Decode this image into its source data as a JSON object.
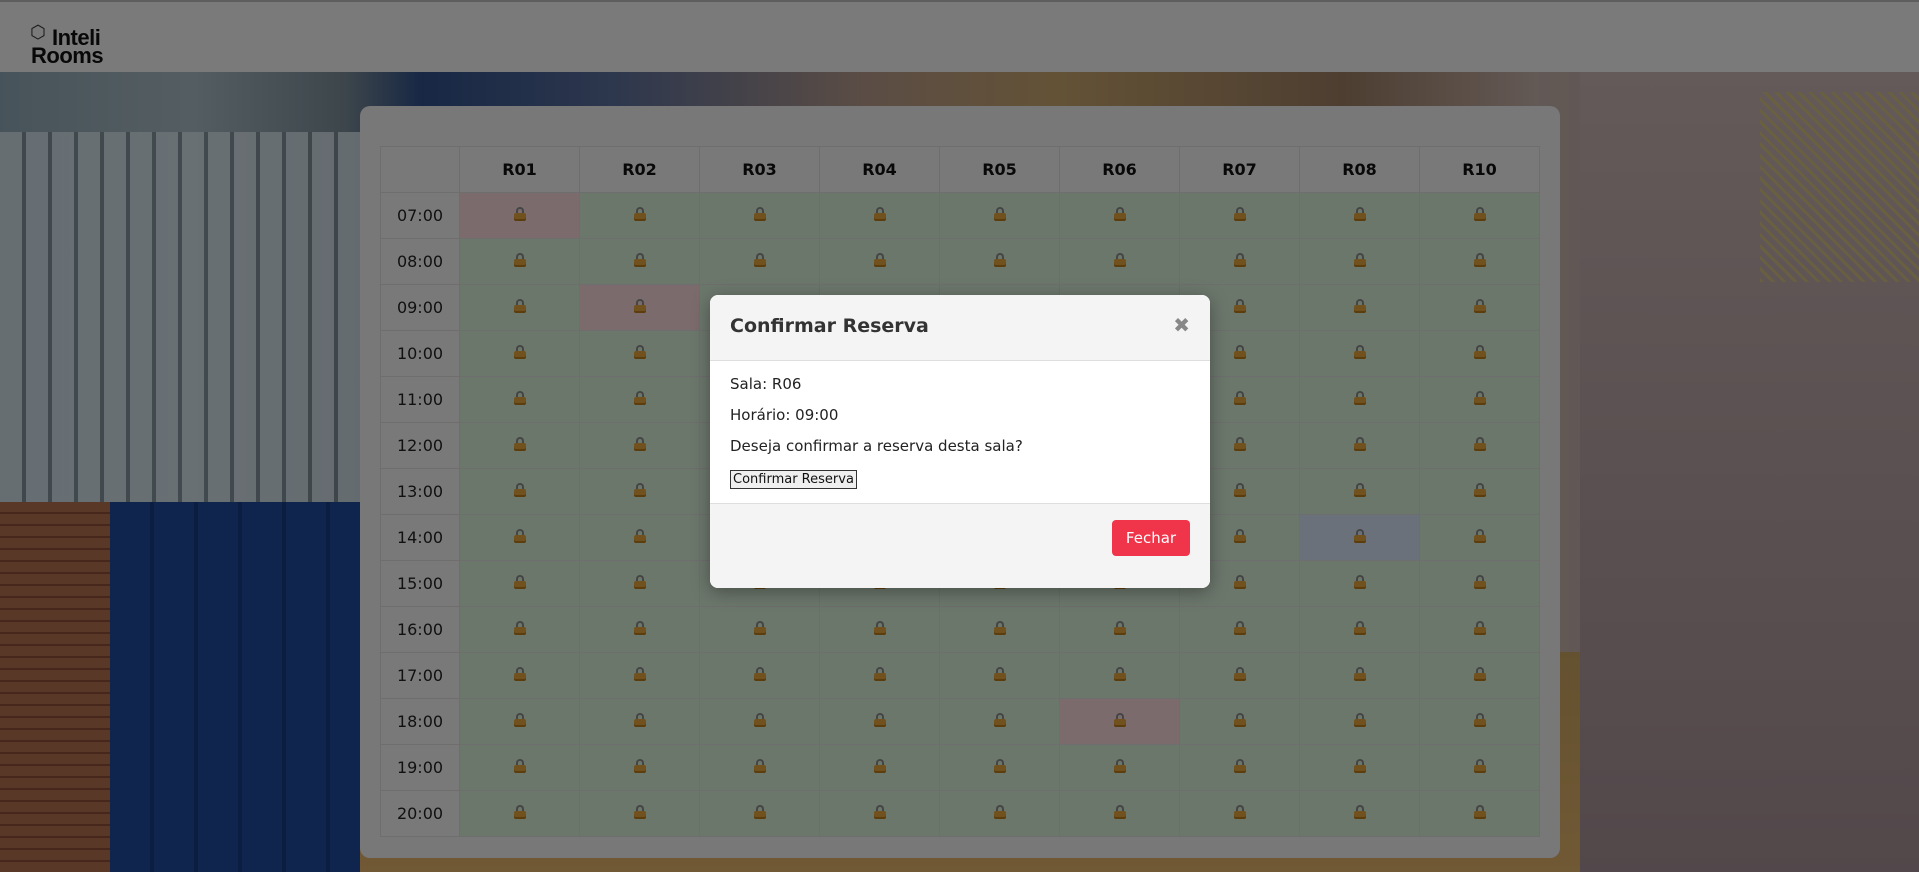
{
  "header": {
    "logo_line1": "Inteli",
    "logo_line2": "Rooms"
  },
  "schedule": {
    "rooms": [
      "R01",
      "R02",
      "R03",
      "R04",
      "R05",
      "R06",
      "R07",
      "R08",
      "R10"
    ],
    "times": [
      "07:00",
      "08:00",
      "09:00",
      "10:00",
      "11:00",
      "12:00",
      "13:00",
      "14:00",
      "15:00",
      "16:00",
      "17:00",
      "18:00",
      "19:00",
      "20:00"
    ],
    "reserved": [
      {
        "time": "07:00",
        "room": "R01"
      },
      {
        "time": "09:00",
        "room": "R02"
      },
      {
        "time": "18:00",
        "room": "R06"
      }
    ],
    "highlighted": [
      {
        "time": "14:00",
        "room": "R08"
      }
    ],
    "cell_icon": "lock-icon",
    "colors": {
      "available": "#d8efd8",
      "reserved": "#f6d6d8",
      "highlighted": "#d6e2f6"
    }
  },
  "modal": {
    "title": "Confirmar Reserva",
    "close_symbol": "✖",
    "sala_line": "Sala: R06",
    "horario_line": "Horário: 09:00",
    "question": "Deseja confirmar a reserva desta sala?",
    "confirm_label": "Confirmar Reserva",
    "close_label": "Fechar",
    "close_button_color": "#f0344a"
  }
}
